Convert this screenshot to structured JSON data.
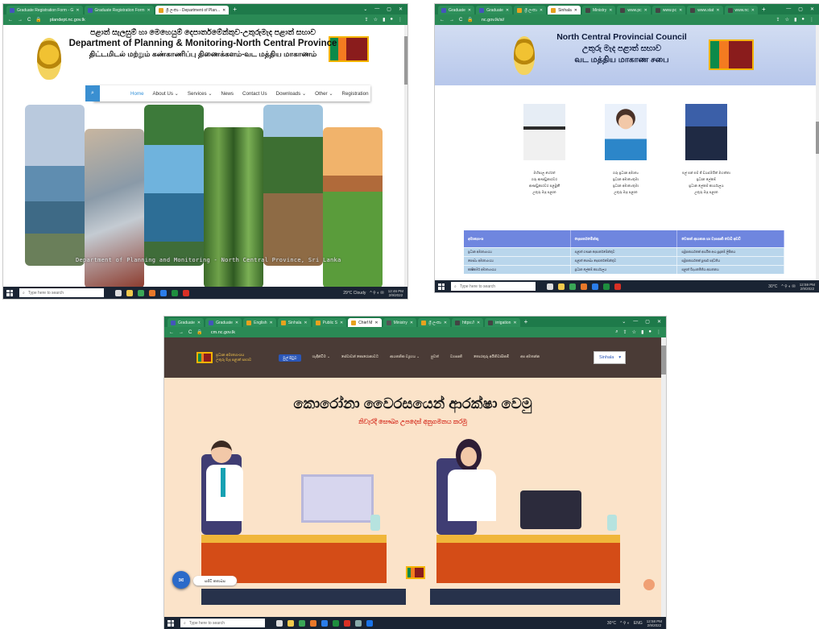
{
  "screens": {
    "planning": {
      "tabs": [
        {
          "label": "Graduate Registration Form - G",
          "active": false
        },
        {
          "label": "Graduate Registration Form",
          "active": false
        },
        {
          "label": "ශ්‍රී ලංකා - Department of Plan...",
          "active": true
        }
      ],
      "url": "plandept.nc.gov.lk",
      "title_si": "පළාත් සැලසුම් හා මෙහෙයුම් දෙපාර්තමේන්තුව-උතුරුමැද පළාත් සභාව",
      "title_en": "Department of Planning & Monitoring-North Central Province",
      "title_ta": "திட்டமிடல் மற்றும் கண்காணிப்பு திணைக்களம்-வட மத்திய மாகாணம்",
      "nav": [
        "Home",
        "About Us ⌄",
        "Services ⌄",
        "News",
        "Contact Us",
        "Downloads ⌄",
        "Other ⌄",
        "Registration"
      ],
      "caption": "Department of Planning and Monitoring - North Central Province, Sri Lanka",
      "taskbar": {
        "search": "Type here to search",
        "weather": "29°C Cloudy",
        "time": "12:46 PM",
        "date": "2/9/2022"
      }
    },
    "council": {
      "tabs": [
        "Graduate",
        "Graduate",
        "ශ්‍රී ලංකා",
        "Sinhala",
        "Ministry",
        "www.pc",
        "www.pc",
        "www.stat",
        "www.nc"
      ],
      "url": "nc.gov.lk/si/",
      "title_en": "North Central Provincial Council",
      "title_si": "උතුරු මැද පළාත් සභාව",
      "title_ta": "வட மத்திய மாகாண சபை",
      "people": [
        {
          "lines": [
            "මහීපාල හේරත්",
            "ගරු ආණ්ඩුකාරවර",
            "ආණ්ඩුකාරවර පළමුකී",
            "උතුරු මැද පළාත"
          ]
        },
        {
          "lines": [
            "ගරු ප්‍රධාන අමාත්‍ය",
            "ප්‍රධාන අමාත්‍යතුමා",
            "ප්‍රධාන අමාත්‍යතුමා",
            "උතුරු මැද පළාත"
          ]
        },
        {
          "lines": [
            "එල් එන් එම් ජී ඩයස්මයිත් මහත්තා",
            "ප්‍රධාන ලේකම්",
            "ප්‍රධාන ලේකම් කාර්යාලය",
            "උතුරු මැද පළාත"
          ]
        }
      ],
      "table_headers": [
        "අමාත්‍යාංශ",
        "දෙපාර්තමේන්තු",
        "වෙනත් ආයතන හා ව්‍යාපෘති වෙබ් අඩවි"
      ],
      "table_rows": [
        [
          "ප්‍රධාන අමාත්‍යාංශය",
          "පළාත් ගණන දෙපාර්තමේන්තුව",
          "සමූපකාර්යතක් ආර්ථික අංශ සූදානම් ලිපිකය"
        ],
        [
          "සෞඛ්‍ය අමාත්‍යාංශය",
          "පළාත් සෞඛ්‍ය දෙපාර්තමේන්තුව",
          "සමූපකාර්යතක් පූර්ණ පද්ධතිය"
        ],
        [
          "කෘෂිකර්ම අමාත්‍යාංශය",
          "ප්‍රධාන ලේකම් කාර්යාලය",
          "පළාත් විද්‍යාතමිතිය ආයතනය"
        ]
      ],
      "taskbar": {
        "search": "Type here to search",
        "weather": "30°C",
        "time": "12:59 PM",
        "date": "2/9/2022"
      }
    },
    "chief_minister": {
      "tabs": [
        "Graduate",
        "Graduate",
        "English",
        "Sinhala",
        "Public S",
        "Chief M",
        "Ministry",
        "ශ්‍රී ලංකා",
        "https://",
        "irrigation"
      ],
      "url": "cm.nc.gov.lk",
      "logo_line1": "ප්‍රධාන අමාත්‍යාංශය",
      "logo_line2": "උතුරු මැද පළාත් සභාව",
      "menu": [
        "මුල් පිටුව",
        "හැඳින්වීම ⌄",
        "සේවාවන් කොරොනාවට",
        "ආයතනික ව්‍යූහය ⌄",
        "පුවත්",
        "ව්‍යාපෘති",
        "තොරතුරු අයිතිවාසිකම්",
        "අප අමතන්න"
      ],
      "lang": "Sinhala",
      "headline": "කොරෝනා වෛරසයෙන් ආරක්ෂා වෙමු",
      "subline": "නිවැරදි සෞඛ්‍ය උපදෙස් අනුගමනය කරමු",
      "chat_label": "සජීවී කතාබස",
      "taskbar": {
        "search": "Type here to search",
        "weather": "30°C",
        "lang": "ENG",
        "time": "12:58 PM",
        "date": "2/9/2022"
      }
    }
  },
  "colors": {
    "chrome": "#1e7a4a",
    "s2_table_head": "#6f86df",
    "s3_nav": "#4a3b36",
    "s3_bg": "#fbe3c9"
  }
}
